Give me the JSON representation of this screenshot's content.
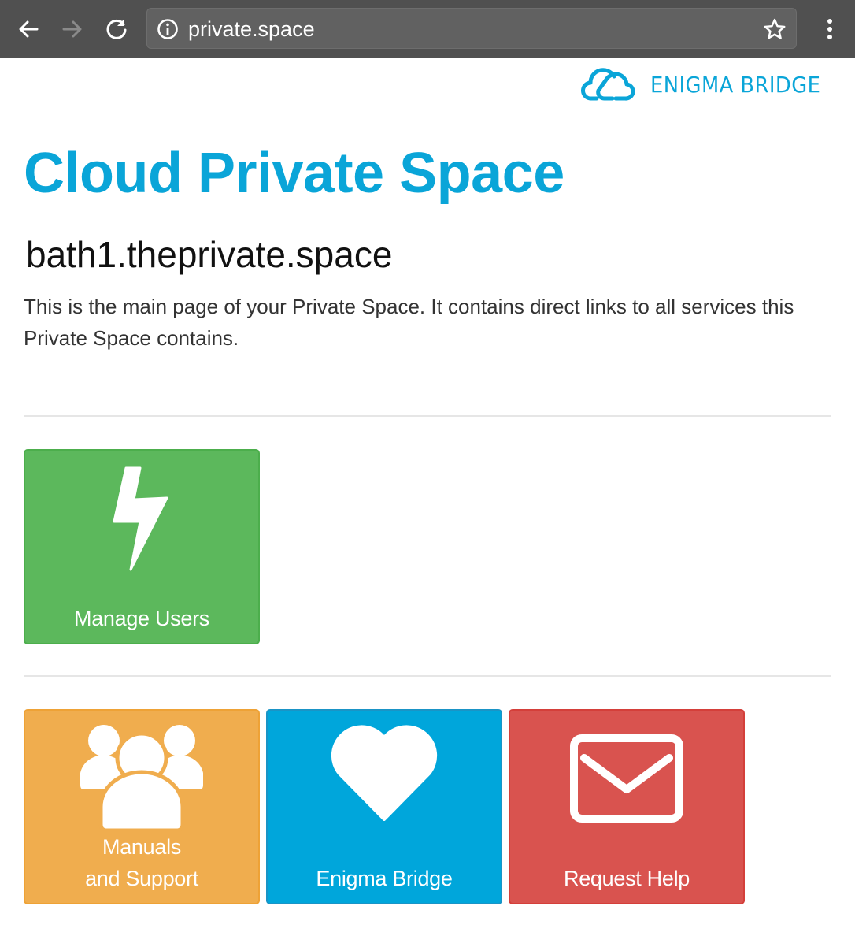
{
  "browser": {
    "url": "private.space",
    "icons": {
      "back": "back-arrow-icon",
      "forward": "forward-arrow-icon",
      "reload": "reload-icon",
      "info": "info-icon",
      "bookmark": "star-icon",
      "menu": "kebab-menu-icon"
    }
  },
  "brand": {
    "logo_text": "ENIGMA BRIDGE",
    "logo_icon": "cloud-logo-icon",
    "color": "#0aa5d8"
  },
  "page": {
    "title": "Cloud Private Space",
    "domain": "bath1.theprivate.space",
    "description": "This is the main page of your Private Space. It contains direct links to all services this Private Space contains."
  },
  "tiles": [
    {
      "label": "Manage Users",
      "icon": "lightning-bolt-icon",
      "color": "#5cb85c"
    },
    {
      "label_line1": "Manuals",
      "label_line2": "and Support",
      "icon": "users-group-icon",
      "color": "#f0ad4e"
    },
    {
      "label": "Enigma Bridge",
      "icon": "heart-icon",
      "color": "#00a6db"
    },
    {
      "label": "Request Help",
      "icon": "envelope-icon",
      "color": "#d9534f"
    }
  ]
}
